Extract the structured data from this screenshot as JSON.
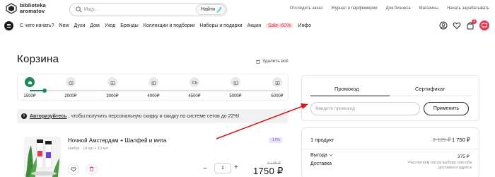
{
  "header": {
    "logo_line1": "biblioteka",
    "logo_line2": "aromatov",
    "search_placeholder": "Ищу...",
    "search_button": "Найти",
    "top_links": [
      "Отследить заказ",
      "Журнал о парфюмерии",
      "Для бизнеса",
      "Магазины",
      "Начать зарабатывать"
    ]
  },
  "nav": {
    "items": [
      "С чего начать?",
      "New",
      "Духи",
      "Дом",
      "Уход",
      "Бренды",
      "Коллекции и подборки",
      "Наборы и подарки",
      "Акции"
    ],
    "sale": "Sale -60%",
    "last": "Инфо",
    "cart_count": "1"
  },
  "cart": {
    "title": "Корзина",
    "delete_all": "Удалить всё",
    "progress_fraction": 0.06,
    "milestones": [
      "1500₽",
      "2000₽",
      "3000₽",
      "4000₽",
      "4500₽",
      "5000₽",
      "6000₽"
    ],
    "notice_link": "Авторизуйтесь",
    "notice_text": ", чтобы получить персональную скидку и скидку по системе сетов до 22%!"
  },
  "product": {
    "name": "Ночной Амстердам + Шалфей и мята",
    "sub": "Набор · 18 мл + 10 мл",
    "discount": "-17%",
    "qty": "1",
    "qty_minus": "−",
    "qty_plus": "+",
    "old_price": "2 125 ₽",
    "price": "1750 ₽"
  },
  "promo": {
    "tab_promo": "Промокод",
    "tab_cert": "Сертификат",
    "input_placeholder": "Введите промокод",
    "apply": "Применить"
  },
  "summary": {
    "count": "1 продукт",
    "old_total": "2 125 ₽",
    "total": "1 750 ₽",
    "benefit_label": "Выгода",
    "benefit_value": "375 ₽",
    "delivery_label": "Доставка",
    "delivery_note": "Рассчитаем после выбора способа доставки и адреса"
  },
  "colors": {
    "accent_green": "#1b8a56",
    "sale_red": "#e23b4f",
    "annotation_red": "#d9141c"
  }
}
